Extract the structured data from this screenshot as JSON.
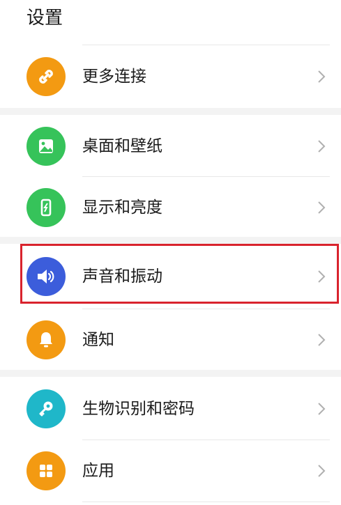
{
  "page": {
    "title": "设置"
  },
  "items": [
    {
      "label": "更多连接",
      "icon": "link-icon",
      "color": "#f39a12"
    },
    {
      "label": "桌面和壁纸",
      "icon": "wallpaper-icon",
      "color": "#36c35a"
    },
    {
      "label": "显示和亮度",
      "icon": "display-brightness-icon",
      "color": "#36c35a"
    },
    {
      "label": "声音和振动",
      "icon": "sound-icon",
      "color": "#3c5ddb"
    },
    {
      "label": "通知",
      "icon": "bell-icon",
      "color": "#f39a12"
    },
    {
      "label": "生物识别和密码",
      "icon": "key-icon",
      "color": "#1fb7c9"
    },
    {
      "label": "应用",
      "icon": "apps-grid-icon",
      "color": "#f39a12"
    }
  ],
  "highlight_color": "#d9232d"
}
